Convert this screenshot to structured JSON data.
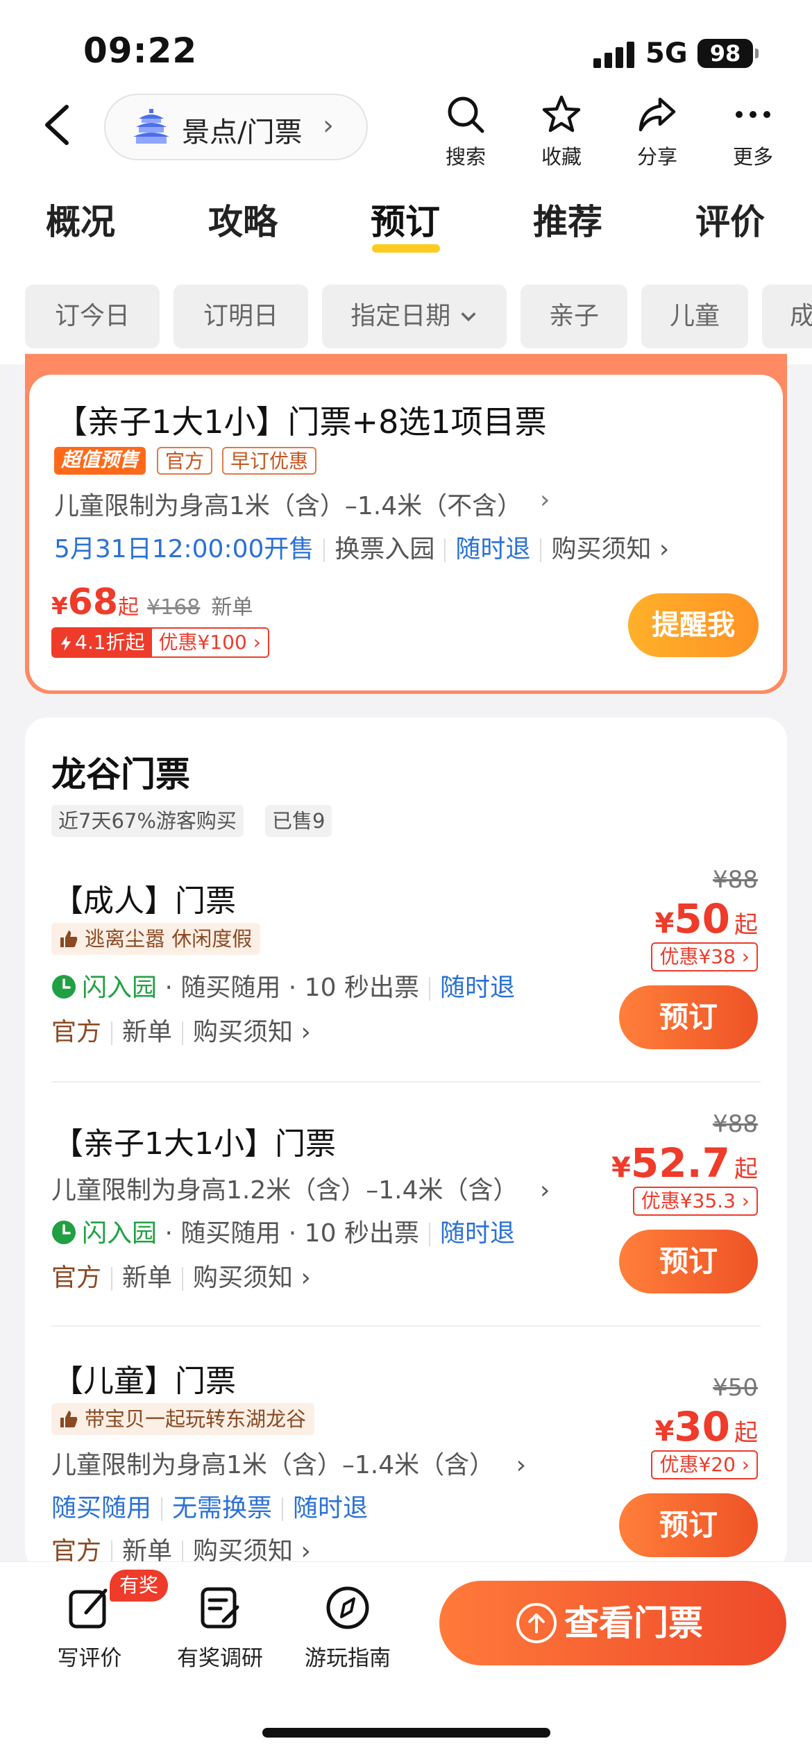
{
  "status": {
    "time": "09:22",
    "network": "5G",
    "battery": "98"
  },
  "header": {
    "category_label": "景点/门票",
    "actions": [
      {
        "icon": "search-icon",
        "label": "搜索"
      },
      {
        "icon": "star-icon",
        "label": "收藏"
      },
      {
        "icon": "share-icon",
        "label": "分享"
      },
      {
        "icon": "more-icon",
        "label": "更多"
      }
    ]
  },
  "tabs": [
    "概况",
    "攻略",
    "预订",
    "推荐",
    "评价"
  ],
  "active_tab": "预订",
  "filters": [
    "订今日",
    "订明日",
    "指定日期",
    "亲子",
    "儿童",
    "成"
  ],
  "presale": {
    "title": "【亲子1大1小】门票+8选1项目票",
    "tags": [
      "超值预售",
      "官方",
      "早订优惠"
    ],
    "limit": "儿童限制为身高1米（含）–1.4米（不含）",
    "sale_time": "5月31日12:00:00开售",
    "features": [
      "换票入园",
      "随时退",
      "购买须知"
    ],
    "price_symbol": "¥",
    "price": "68",
    "price_suffix": "起",
    "original_price": "¥168",
    "new_user": "新单",
    "discount_rate": "4.1折起",
    "discount_amount": "优惠¥100",
    "button": "提醒我"
  },
  "section": {
    "title": "龙谷门票",
    "stats": [
      "近7天67%游客购买",
      "已售9"
    ],
    "products": [
      {
        "title": "【成人】门票",
        "praise": "逃离尘嚣 休闲度假",
        "fast_entry": "闪入园",
        "features": "· 随买随用 · 10 秒出票",
        "refund": "随时退",
        "meta": [
          "官方",
          "新单",
          "购买须知"
        ],
        "original_price": "¥88",
        "price": "50",
        "coupon": "优惠¥38",
        "button": "预订"
      },
      {
        "title": "【亲子1大1小】门票",
        "limit": "儿童限制为身高1.2米（含）–1.4米（含）",
        "fast_entry": "闪入园",
        "features": "· 随买随用 · 10 秒出票",
        "refund": "随时退",
        "meta": [
          "官方",
          "新单",
          "购买须知"
        ],
        "original_price": "¥88",
        "price": "52.7",
        "coupon": "优惠¥35.3",
        "button": "预订"
      },
      {
        "title": "【儿童】门票",
        "praise": "带宝贝一起玩转东湖龙谷",
        "limit": "儿童限制为身高1米（含）–1.4米（含）",
        "links": [
          "随买随用",
          "无需换票",
          "随时退"
        ],
        "meta": [
          "官方",
          "新单",
          "购买须知"
        ],
        "original_price": "¥50",
        "price": "30",
        "coupon": "优惠¥20",
        "button": "预订"
      }
    ],
    "price_symbol": "¥",
    "price_suffix": "起"
  },
  "bottom_bar": {
    "items": [
      {
        "icon": "edit-review-icon",
        "label": "写评价"
      },
      {
        "icon": "survey-icon",
        "label": "有奖调研"
      },
      {
        "icon": "compass-icon",
        "label": "游玩指南"
      }
    ],
    "reward_badge": "有奖",
    "view_button": "查看门票"
  },
  "colors": {
    "accent_red": "#ee3b2a",
    "accent_orange": "#ff7a3a",
    "tab_underline": "#ffcb1f",
    "link_blue": "#2a71d6"
  }
}
